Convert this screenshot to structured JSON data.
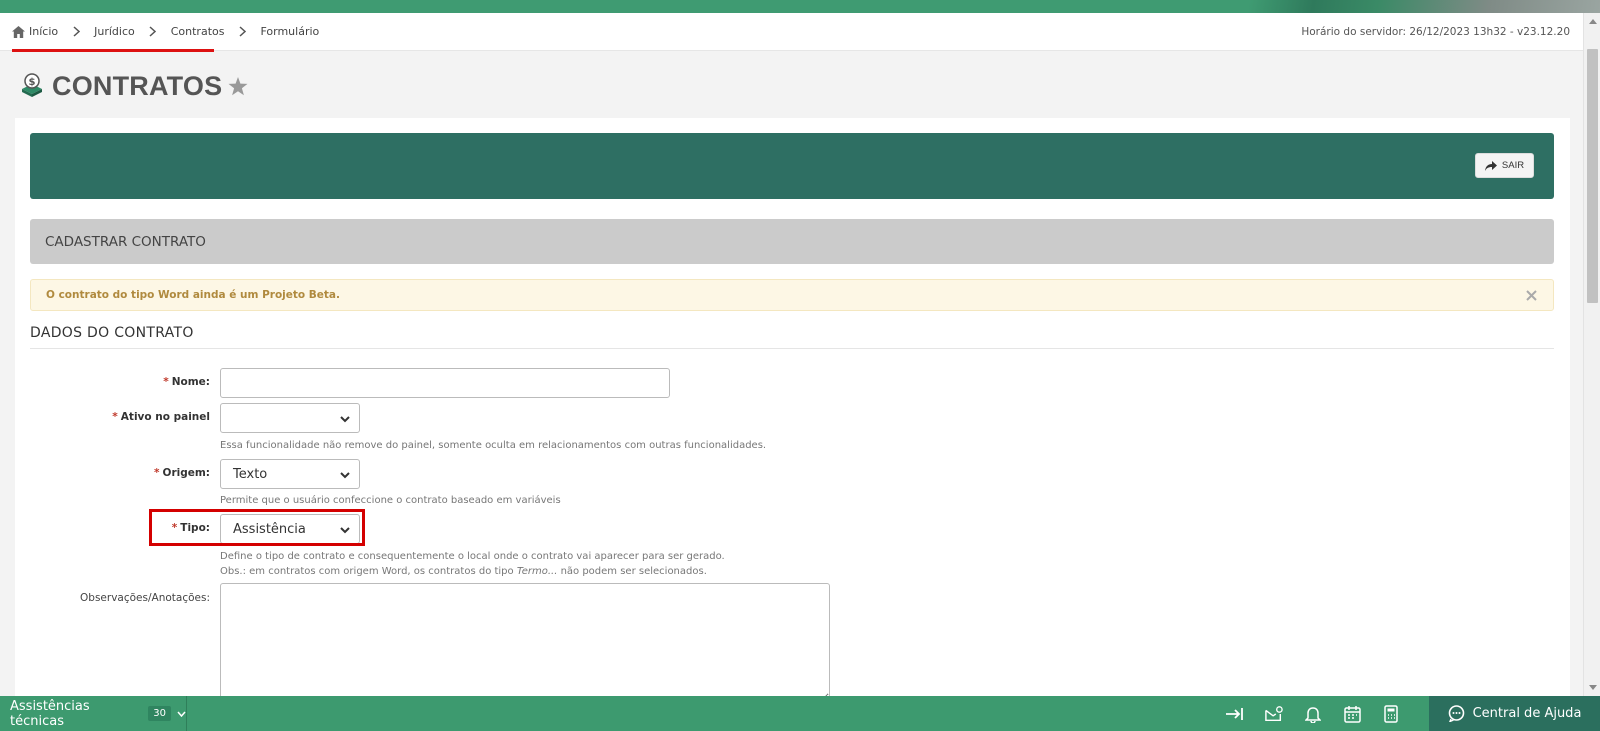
{
  "breadcrumb": {
    "items": [
      "Início",
      "Jurídico",
      "Contratos",
      "Formulário"
    ]
  },
  "server_time": "Horário do servidor: 26/12/2023 13h32 - v23.12.20",
  "page": {
    "title": "CONTRATOS"
  },
  "header": {
    "exit_label": "SAIR"
  },
  "section": {
    "title": "CADASTRAR CONTRATO"
  },
  "alert": {
    "message": "O contrato do tipo Word ainda é um Projeto Beta."
  },
  "form": {
    "section_title": "DADOS DO CONTRATO",
    "required_mark": "*",
    "nome": {
      "label": "Nome:",
      "value": ""
    },
    "ativo": {
      "label": "Ativo no painel",
      "value": "",
      "help": "Essa funcionalidade não remove do painel, somente oculta em relacionamentos com outras funcionalidades."
    },
    "origem": {
      "label": "Origem:",
      "value": "Texto",
      "help": "Permite que o usuário confeccione o contrato baseado em variáveis"
    },
    "tipo": {
      "label": "Tipo:",
      "value": "Assistência",
      "help1": "Define o tipo de contrato e consequentemente o local onde o contrato vai aparecer para ser gerado.",
      "help2_prefix": "Obs.: em contratos com origem Word, os contratos do tipo ",
      "help2_em": "Termo...",
      "help2_suffix": " não podem ser selecionados."
    },
    "observacoes": {
      "label": "Observações/Anotações:",
      "value": ""
    }
  },
  "bottom_bar": {
    "module_label": "Assistências técnicas",
    "module_count": "30",
    "help_center_label": "Central de Ajuda"
  },
  "colors": {
    "brand_green": "#3d9a6f",
    "header_green": "#2e6f63",
    "highlight_red": "#d40000",
    "alert_text": "#b08a3e"
  }
}
